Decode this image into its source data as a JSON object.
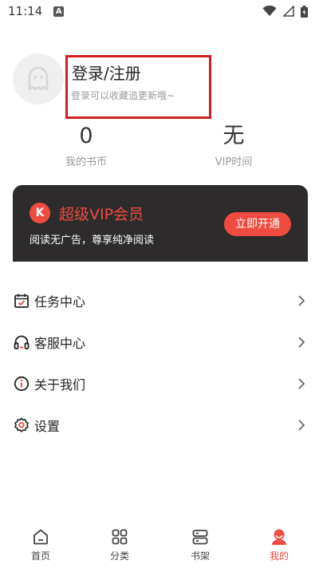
{
  "status_bar": {
    "time": "11:14",
    "notification_badge": "A"
  },
  "profile": {
    "login_title": "登录/注册",
    "login_subtitle": "登录可以收藏追更新哦~"
  },
  "stats": {
    "coins_value": "0",
    "coins_label": "我的书币",
    "vip_value": "无",
    "vip_label": "VIP时间"
  },
  "vip_banner": {
    "logo_text": "K",
    "title": "超级VIP会员",
    "subtitle": "阅读无广告，尊享纯净阅读",
    "button_label": "立即开通"
  },
  "menu": {
    "items": [
      {
        "label": "任务中心",
        "icon": "calendar-check-icon"
      },
      {
        "label": "客服中心",
        "icon": "headset-icon"
      },
      {
        "label": "关于我们",
        "icon": "info-icon"
      },
      {
        "label": "设置",
        "icon": "gear-icon"
      }
    ]
  },
  "tab_bar": {
    "tabs": [
      {
        "label": "首页",
        "icon": "home-icon",
        "active": false
      },
      {
        "label": "分类",
        "icon": "grid-icon",
        "active": false
      },
      {
        "label": "书架",
        "icon": "bookshelf-icon",
        "active": false
      },
      {
        "label": "我的",
        "icon": "user-icon",
        "active": true
      }
    ]
  },
  "colors": {
    "accent": "#ef4b40",
    "vip_banner_bg": "#2d2b2c",
    "highlight_border": "#d42020"
  }
}
